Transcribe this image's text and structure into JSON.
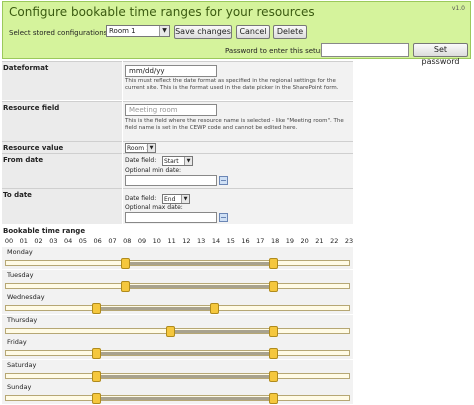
{
  "header": {
    "title": "Configure bookable time ranges for your resources",
    "version": "v1.0",
    "stored_label": "Select stored configurations:",
    "selected_config": "Room 1",
    "save_label": "Save changes",
    "cancel_label": "Cancel",
    "delete_label": "Delete",
    "password_label": "Password to enter this setup:",
    "set_password_label": "Set password"
  },
  "form": {
    "dateformat": {
      "label": "Dateformat",
      "value": "mm/dd/yy",
      "help": "This must reflect the date format as specified in the regional settings for the current site. This is the format used in the date picker in the SharePoint form."
    },
    "resource_field": {
      "label": "Resource field",
      "placeholder": "Meeting room",
      "help": "This is the field where the resource name is selected - like \"Meeting room\". The field name is set in the CEWP code and cannot be edited here."
    },
    "resource_value": {
      "label": "Resource value",
      "selected": "Room 1"
    },
    "from_date": {
      "label": "From date",
      "field_label": "Date field:",
      "field_value": "Start",
      "optional_label": "Optional min date:"
    },
    "to_date": {
      "label": "To date",
      "field_label": "Date field:",
      "field_value": "End",
      "optional_label": "Optional max date:"
    }
  },
  "time_range": {
    "title": "Bookable time range",
    "hours": [
      "00",
      "01",
      "02",
      "03",
      "04",
      "05",
      "06",
      "07",
      "08",
      "09",
      "10",
      "11",
      "12",
      "13",
      "14",
      "15",
      "16",
      "17",
      "18",
      "19",
      "20",
      "21",
      "22",
      "23"
    ],
    "days": [
      {
        "name": "Monday",
        "start": 8,
        "end": 18
      },
      {
        "name": "Tuesday",
        "start": 8,
        "end": 18
      },
      {
        "name": "Wednesday",
        "start": 6,
        "end": 14
      },
      {
        "name": "Thursday",
        "start": 11,
        "end": 18
      },
      {
        "name": "Friday",
        "start": 6,
        "end": 18
      },
      {
        "name": "Saturday",
        "start": 6,
        "end": 18
      },
      {
        "name": "Sunday",
        "start": 6,
        "end": 18
      }
    ]
  }
}
